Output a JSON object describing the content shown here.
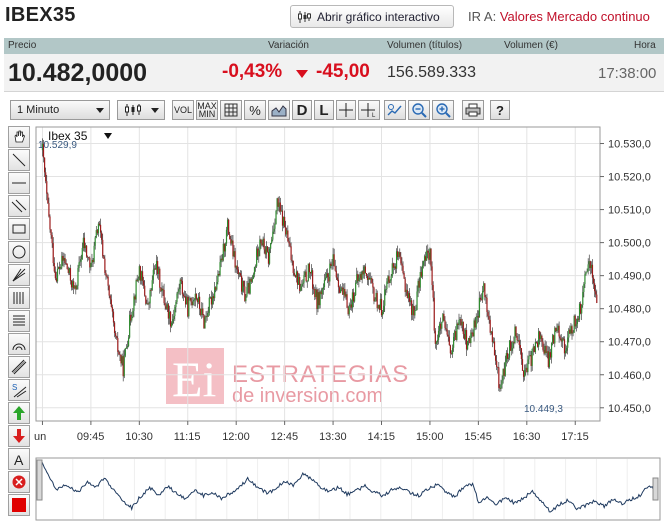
{
  "title": "IBEX35",
  "interactive_button": "Abrir gráfico interactivo",
  "ira": {
    "prefix": "IR A:",
    "link": "Valores Mercado continuo"
  },
  "header": {
    "precio": "Precio",
    "variacion": "Variación",
    "vol_titulos": "Volumen (títulos)",
    "vol_euros": "Volumen (€)",
    "hora": "Hora"
  },
  "values": {
    "price": "10.482,0000",
    "pct": "-0,43%",
    "abs": "-45,00",
    "volume": "156.589.333",
    "time": "17:38:00"
  },
  "toolbar": {
    "interval": "1 Minuto",
    "vol": "VOL",
    "maxmin_top": "MAX",
    "maxmin_bottom": "MIN",
    "percent": "%",
    "d": "D",
    "l": "L",
    "help": "?"
  },
  "left_tools": [
    "hand-icon",
    "line-diag-icon",
    "line-horiz-icon",
    "parallel-lines-icon",
    "rectangle-icon",
    "circle-icon",
    "fan-icon",
    "vertical-lines-icon",
    "horizontal-lines-icon",
    "arc-icon",
    "channel-icon",
    "speed-lines-icon",
    "buy-arrow-icon",
    "sell-arrow-icon",
    "text-icon",
    "delete-icon",
    "color-icon"
  ],
  "watermark": {
    "logo": "Ei",
    "line1": "ESTRATEGIAS",
    "line2": "de inversion.com"
  },
  "chart_data": {
    "type": "candlestick",
    "series_label": "Ibex 35",
    "high_label": "10.529,9",
    "low_label": "10.449,3",
    "x_ticks": [
      "9:00",
      "09:45",
      "10:30",
      "11:15",
      "12:00",
      "12:45",
      "13:30",
      "14:15",
      "15:00",
      "15:45",
      "16:30",
      "17:15"
    ],
    "x_first_tick_visible": "un",
    "y_ticks": [
      "10.450,0",
      "10.460,0",
      "10.470,0",
      "10.480,0",
      "10.490,0",
      "10.500,0",
      "10.510,0",
      "10.520,0",
      "10.530,0"
    ],
    "ylim": [
      10446,
      10535
    ],
    "colors": {
      "up": "#2e8b2e",
      "down": "#9c1a1a",
      "wick": "#222222",
      "overview_line": "#1f3a5f"
    },
    "close_path": [
      [
        "9:00",
        10528
      ],
      [
        "9:05",
        10510
      ],
      [
        "9:12",
        10490
      ],
      [
        "9:20",
        10495
      ],
      [
        "9:30",
        10485
      ],
      [
        "9:38",
        10500
      ],
      [
        "9:45",
        10492
      ],
      [
        "9:52",
        10506
      ],
      [
        "10:00",
        10488
      ],
      [
        "10:08",
        10470
      ],
      [
        "10:15",
        10462
      ],
      [
        "10:22",
        10478
      ],
      [
        "10:30",
        10492
      ],
      [
        "10:38",
        10480
      ],
      [
        "10:45",
        10494
      ],
      [
        "10:52",
        10484
      ],
      [
        "11:00",
        10476
      ],
      [
        "11:08",
        10488
      ],
      [
        "11:15",
        10480
      ],
      [
        "11:22",
        10485
      ],
      [
        "11:30",
        10476
      ],
      [
        "11:38",
        10484
      ],
      [
        "11:45",
        10492
      ],
      [
        "11:52",
        10505
      ],
      [
        "12:00",
        10492
      ],
      [
        "12:08",
        10484
      ],
      [
        "12:15",
        10488
      ],
      [
        "12:22",
        10502
      ],
      [
        "12:30",
        10495
      ],
      [
        "12:38",
        10512
      ],
      [
        "12:45",
        10505
      ],
      [
        "12:52",
        10494
      ],
      [
        "13:00",
        10486
      ],
      [
        "13:08",
        10492
      ],
      [
        "13:15",
        10482
      ],
      [
        "13:22",
        10487
      ],
      [
        "13:30",
        10494
      ],
      [
        "13:38",
        10485
      ],
      [
        "13:45",
        10480
      ],
      [
        "13:52",
        10488
      ],
      [
        "14:00",
        10492
      ],
      [
        "14:08",
        10484
      ],
      [
        "14:15",
        10480
      ],
      [
        "14:22",
        10490
      ],
      [
        "14:30",
        10496
      ],
      [
        "14:38",
        10486
      ],
      [
        "14:45",
        10478
      ],
      [
        "14:52",
        10492
      ],
      [
        "15:00",
        10498
      ],
      [
        "15:05",
        10470
      ],
      [
        "15:12",
        10476
      ],
      [
        "15:20",
        10466
      ],
      [
        "15:28",
        10479
      ],
      [
        "15:35",
        10468
      ],
      [
        "15:42",
        10476
      ],
      [
        "15:50",
        10486
      ],
      [
        "15:58",
        10470
      ],
      [
        "16:05",
        10456
      ],
      [
        "16:12",
        10466
      ],
      [
        "16:20",
        10474
      ],
      [
        "16:28",
        10460
      ],
      [
        "16:35",
        10466
      ],
      [
        "16:42",
        10472
      ],
      [
        "16:50",
        10464
      ],
      [
        "16:58",
        10476
      ],
      [
        "17:05",
        10468
      ],
      [
        "17:12",
        10474
      ],
      [
        "17:20",
        10480
      ],
      [
        "17:28",
        10496
      ],
      [
        "17:35",
        10482
      ]
    ],
    "candles": [],
    "overview_chart": {
      "type": "line",
      "description_visible": false
    }
  }
}
